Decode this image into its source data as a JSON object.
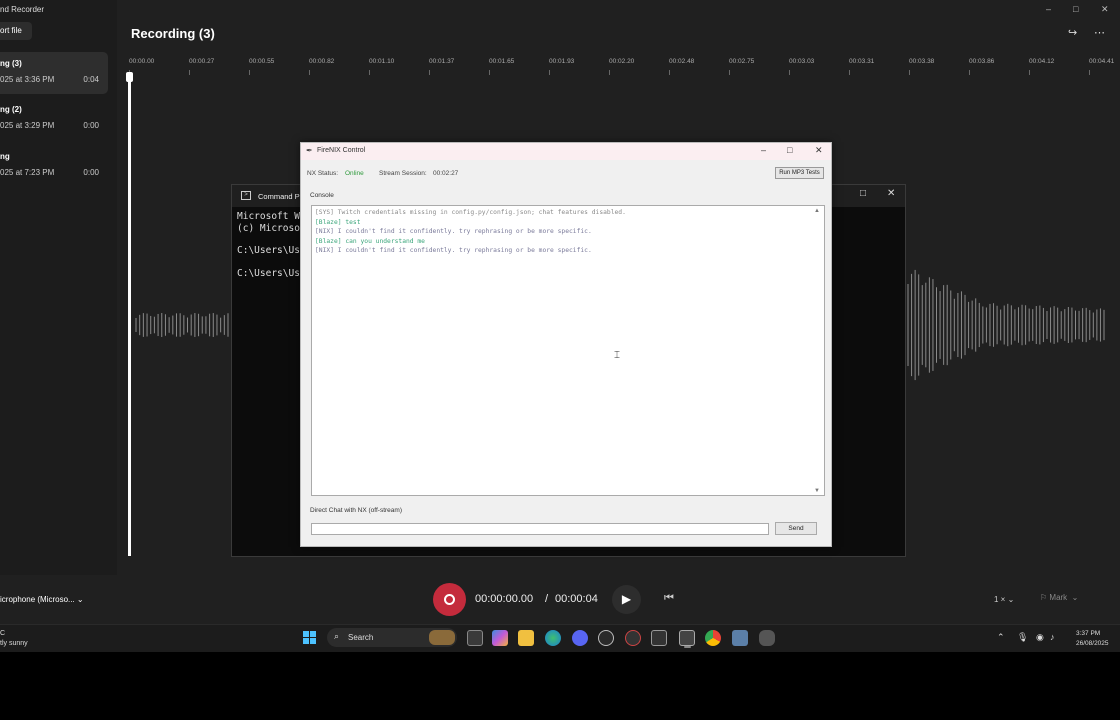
{
  "recorder": {
    "app_title": "nd Recorder",
    "import_label": "ort file",
    "items": [
      {
        "name": "ng (3)",
        "date": "025 at 3:36 PM",
        "duration": "0:04"
      },
      {
        "name": "ng (2)",
        "date": "025 at 3:29 PM",
        "duration": "0:00"
      },
      {
        "name": "ng",
        "date": "025 at 7:23 PM",
        "duration": "0:00"
      }
    ],
    "main_title": "Recording (3)",
    "timeline_ticks": [
      "00:00.00",
      "00:00.27",
      "00:00.55",
      "00:00.82",
      "00:01.10",
      "00:01.37",
      "00:01.65",
      "00:01.93",
      "00:02.20",
      "00:02.48",
      "00:02.75",
      "00:03.03",
      "00:03.31",
      "00:03.38",
      "00:03.86",
      "00:04.12",
      "00:04.41"
    ],
    "mic_label": "icrophone (Microso... ⌄",
    "current_time": "00:00:00.00",
    "separator": "/",
    "total_time": "00:00:04",
    "speed": "1 ×  ⌄",
    "mark": "Mark",
    "window_controls": [
      "–",
      "□",
      "✕"
    ]
  },
  "cmd": {
    "title": "Command P",
    "lines": [
      "Microsoft Wi",
      "(c) Microso",
      "C:\\Users\\Use",
      "C:\\Users\\Use"
    ]
  },
  "nix": {
    "title": "FireNIX Control",
    "status_label": "NX Status:",
    "status_value": "Online",
    "session_label": "Stream Session:",
    "session_value": "00:02:27",
    "run_tests": "Run MP3 Tests",
    "console_label": "Console",
    "logs": [
      {
        "text": "[SYS] Twitch credentials missing in config.py/config.json; chat features disabled.",
        "color": "#8a8a8a"
      },
      {
        "text": "[Blaze] test",
        "color": "#3aa57a"
      },
      {
        "text": "[NIX] I couldn't find it confidently. try rephrasing or be more specific.",
        "color": "#7a7a9a"
      },
      {
        "text": "[Blaze] can you understand me",
        "color": "#3aa57a"
      },
      {
        "text": "[NIX] I couldn't find it confidently. try rephrasing or be more specific.",
        "color": "#7a7a9a"
      }
    ],
    "chat_label": "Direct Chat with NX (off-stream)",
    "chat_value": "",
    "send": "Send"
  },
  "taskbar": {
    "weather_temp": "C",
    "weather_desc": "tly sunny",
    "search": "Search",
    "time": "3:37 PM",
    "date": "26/08/2025"
  },
  "colors": {
    "record": "#c42b3c",
    "online": "#2e9a3c",
    "accent": "#4cc2ff"
  }
}
